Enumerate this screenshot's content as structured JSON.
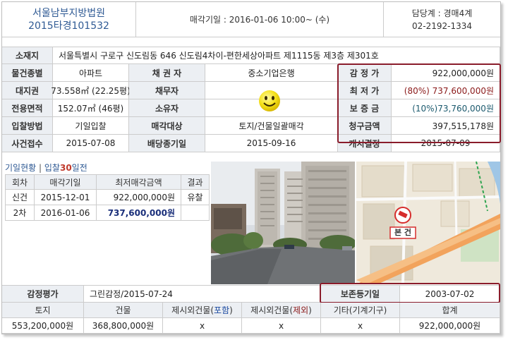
{
  "header": {
    "court": "서울남부지방법원",
    "case_no": "2015타경101532",
    "sale_date": "매각기일 : 2016-01-06   10:00~ (수)",
    "department": "담당계 : 경매4계",
    "phone": "02-2192-1334"
  },
  "property": {
    "location_label": "소재지",
    "location_value": "서울특별시 구로구 신도림동 646 신도림4차이-편한세상아파트 제1115동 제3층 제301호",
    "rows": [
      {
        "l1": "물건종별",
        "v1": "아파트",
        "l2": "채 권 자",
        "v2": "중소기업은행",
        "l3": "감 정 가",
        "v3": "922,000,000원"
      },
      {
        "l1": "대지권",
        "v1": "73.558㎡ (22.25평)",
        "l2": "채무자",
        "v2": "",
        "l3": "최 저 가",
        "v3": "(80%) 737,600,000원"
      },
      {
        "l1": "전용면적",
        "v1": "152.07㎡ (46평)",
        "l2": "소유자",
        "v2": "",
        "l3": "보 증 금",
        "v3": "(10%)73,760,000원"
      },
      {
        "l1": "입찰방법",
        "v1": "기일입찰",
        "l2": "매각대상",
        "v2": "토지/건물일괄매각",
        "l3": "청구금액",
        "v3": "397,515,178원"
      },
      {
        "l1": "사건접수",
        "v1": "2015-07-08",
        "l2": "배당종기일",
        "v2": "2015-09-16",
        "l3": "개시결정",
        "v3": "2015-07-09"
      }
    ]
  },
  "bid_history": {
    "title_prefix": "기일현황",
    "title_link": "입찰",
    "title_num": "30",
    "title_suffix": "일전",
    "headers": [
      "회차",
      "매각기일",
      "최저매각금액",
      "결과"
    ],
    "rows": [
      {
        "round": "신건",
        "date": "2015-12-01",
        "amount": "922,000,000원",
        "result": "유찰"
      },
      {
        "round": "2차",
        "date": "2016-01-06",
        "amount": "737,600,000원",
        "result": ""
      }
    ]
  },
  "map": {
    "marker_label": "본 건"
  },
  "appraisal": {
    "label": "감정평가",
    "value": "그린감정/2015-07-24",
    "preserve_label": "보존등기일",
    "preserve_value": "2003-07-02",
    "headers": {
      "land": "토지",
      "building": "건물",
      "excl_incl_pre": "제시외건물(",
      "excl_incl_em": "포함",
      "excl_excl_pre": "제시외건물(",
      "excl_excl_em": "제외",
      "other": "기타(기계기구)",
      "total": "합계"
    },
    "values": {
      "land": "553,200,000원",
      "building": "368,800,000원",
      "excl_incl": "x",
      "excl_excl": "x",
      "other": "x",
      "total": "922,000,000원"
    }
  },
  "colors": {
    "court_blue": "#2f5a94",
    "highlight_border": "#8a1c2b",
    "label_bg": "#eceff3"
  }
}
